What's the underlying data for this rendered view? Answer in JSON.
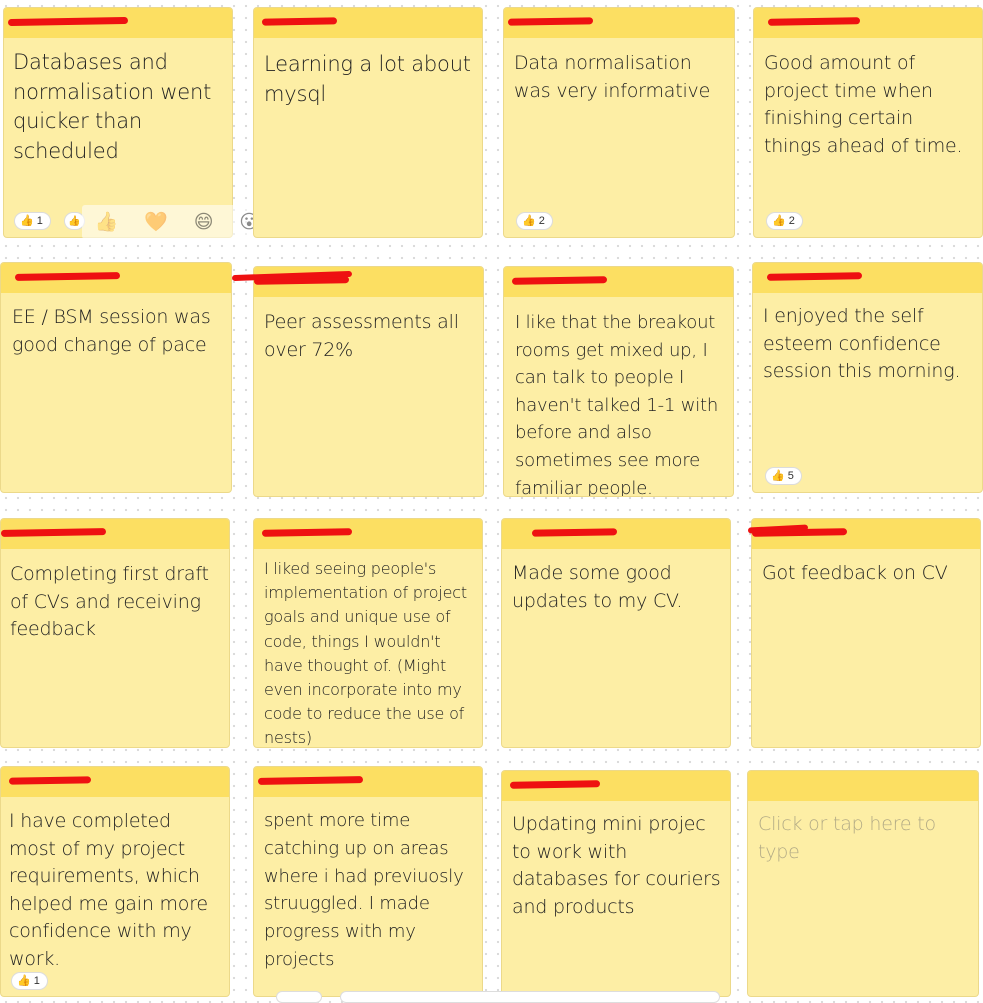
{
  "notes": [
    {
      "text": "Databases and normalisation went quicker than scheduled",
      "reactions": [
        {
          "icon": "thumbs-up",
          "count": "1"
        }
      ]
    },
    {
      "text": "Learning a lot about mysql",
      "reactions": []
    },
    {
      "text": "Data normalisation was very informative",
      "reactions": [
        {
          "icon": "thumbs-up",
          "count": "2"
        }
      ]
    },
    {
      "text": "Good amount of project time when finishing certain things ahead of time.",
      "reactions": [
        {
          "icon": "thumbs-up",
          "count": "2"
        }
      ]
    },
    {
      "text": "EE / BSM session was good change of pace",
      "reactions": []
    },
    {
      "text": "Peer assessments all over 72%",
      "reactions": []
    },
    {
      "text": "I like that the breakout rooms get mixed up, I can talk to people I haven't talked 1-1 with before and also sometimes see more familiar people.",
      "reactions": []
    },
    {
      "text": "I enjoyed the self esteem confidence session this morning.",
      "reactions": [
        {
          "icon": "thumbs-up",
          "count": "5"
        }
      ]
    },
    {
      "text": "Completing first draft of CVs and receiving feedback",
      "reactions": []
    },
    {
      "text": "I liked seeing people's implementation of project goals and unique use of code, things I wouldn't have thought of. (Might even incorporate into my code to reduce the use of nests)",
      "reactions": []
    },
    {
      "text": "Made some good updates to my CV.",
      "reactions": []
    },
    {
      "text": "Got feedback on CV",
      "reactions": []
    },
    {
      "text": "I have completed most of my project requirements, which helped me gain more confidence with my work.",
      "reactions": [
        {
          "icon": "thumbs-up",
          "count": "1"
        }
      ]
    },
    {
      "text": "spent more time catching up on areas where i had previuosly struuggled. I made progress with my projects",
      "reactions": []
    },
    {
      "text": "Updating mini projec to work with databases for couriers and products",
      "reactions": []
    },
    {
      "text": "",
      "placeholder": "Click or tap here to type",
      "reactions": []
    }
  ],
  "reaction_picker": {
    "icons": [
      "thumbs-up-icon",
      "heart-icon",
      "laugh-icon",
      "surprised-icon"
    ],
    "glyphs": [
      "👍",
      "🧡",
      "😄",
      "😮"
    ]
  },
  "colors": {
    "note_body": "#fdeea5",
    "note_header": "#fcdf62",
    "redaction": "#ee1111"
  }
}
